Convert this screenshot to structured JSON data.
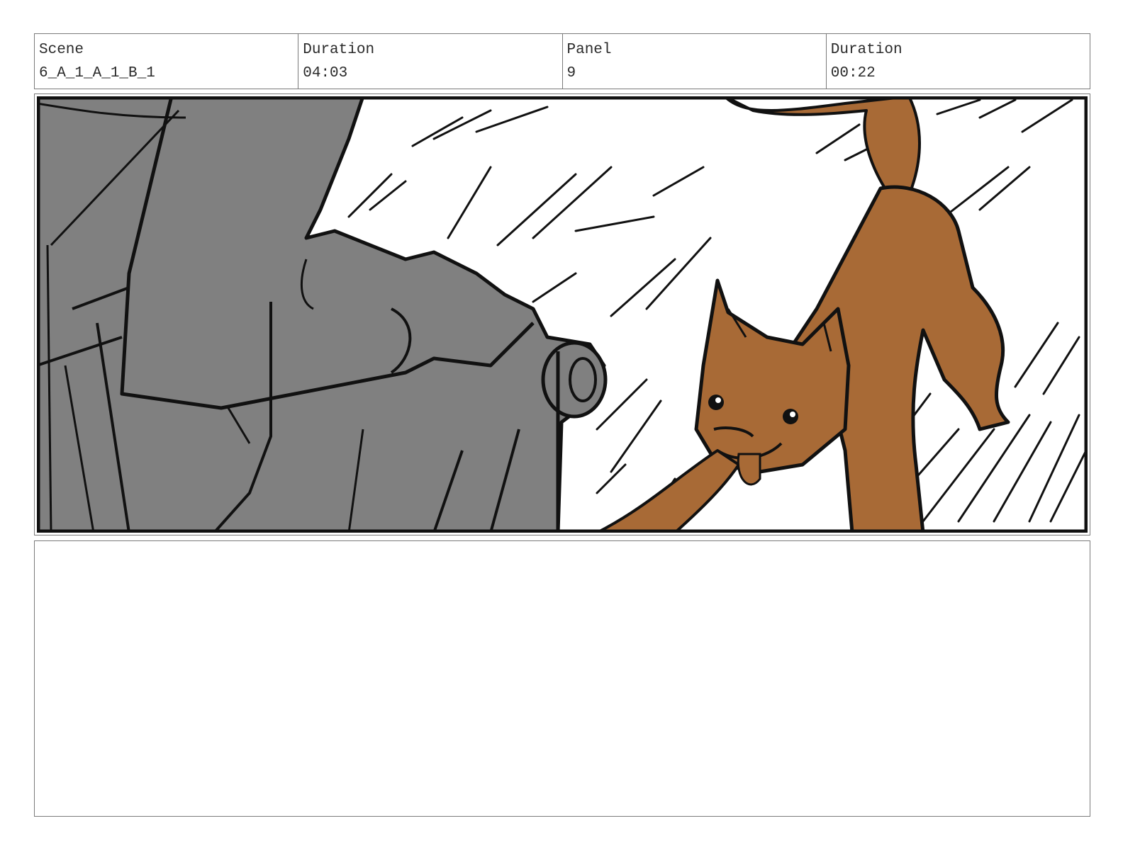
{
  "header": {
    "scene_label": "Scene",
    "scene_value": "6_A_1_A_1_B_1",
    "duration_label": "Duration",
    "duration_value": "04:03",
    "panel_label": "Panel",
    "panel_value": "9",
    "panel_duration_label": "Duration",
    "panel_duration_value": "00:22"
  },
  "panel_image": {
    "subject": "cat-and-gloved-hand",
    "colors": {
      "hand_gray": "#808080",
      "cat_brown": "#a86a36",
      "ink": "#111111",
      "background": "#ffffff"
    }
  },
  "notes": {
    "text": ""
  }
}
